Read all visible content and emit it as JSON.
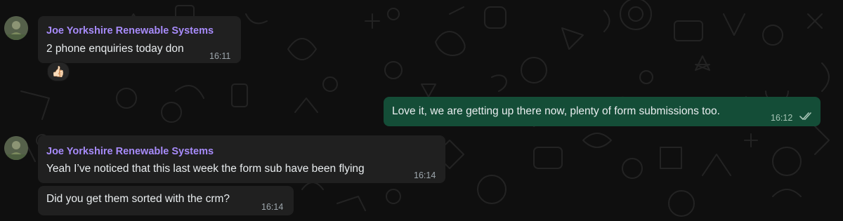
{
  "theme": {
    "background": "#0f0f0f",
    "incoming_bubble": "#202020",
    "outgoing_bubble": "#144d37",
    "sender_name_color": "#a78bfa",
    "text_color": "#e9edef",
    "timestamp_color": "#9ea7ad",
    "read_ticks_color": "#a7c5b6"
  },
  "messages": [
    {
      "direction": "incoming",
      "sender": "Joe Yorkshire Renewable Systems",
      "text": "2 phone enquiries today don",
      "time": "16:11",
      "reaction": "👍🏻",
      "avatar_icon": "contact-avatar-icon"
    },
    {
      "direction": "outgoing",
      "text": "Love it, we are getting up there now, plenty of form submissions too.",
      "time": "16:12",
      "status_icon": "double-check-read-icon"
    },
    {
      "direction": "incoming",
      "sender": "Joe Yorkshire Renewable Systems",
      "text": "Yeah I’ve noticed that this last week the form sub have been flying",
      "time": "16:14",
      "avatar_icon": "contact-avatar-icon"
    },
    {
      "direction": "incoming",
      "text": "Did you get them sorted with the crm?",
      "time": "16:14"
    }
  ]
}
